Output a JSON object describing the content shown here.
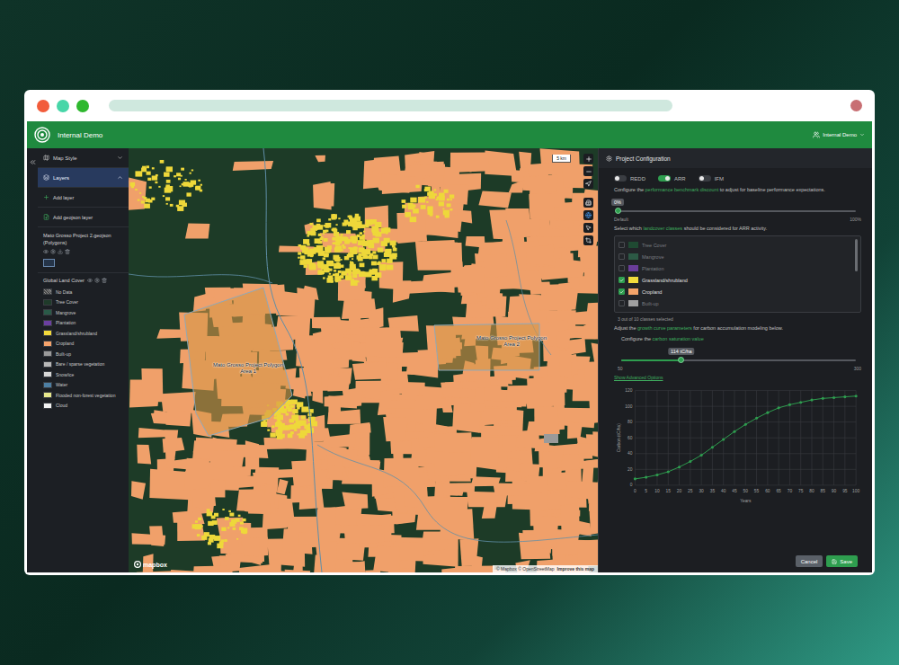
{
  "header": {
    "title": "Internal Demo",
    "account": "Internal Demo"
  },
  "sidebar": {
    "sections": [
      {
        "label": "Map Style",
        "selected": false,
        "expanded": false
      },
      {
        "label": "Layers",
        "selected": true,
        "expanded": true
      }
    ],
    "actions": [
      "Add layer",
      "Add geojson layer"
    ],
    "layer": {
      "name": "Mato Grosso Project 2.geojson (Polygons)"
    },
    "legend": {
      "title": "Global Land Cover",
      "items": [
        {
          "label": "No Data",
          "color": "#4a4a4a",
          "kind": "hatched"
        },
        {
          "label": "Tree Cover",
          "color": "#1f3b2a",
          "kind": "solid"
        },
        {
          "label": "Mangrove",
          "color": "#2a5a48",
          "kind": "solid"
        },
        {
          "label": "Plantation",
          "color": "#6b3fa0",
          "kind": "solid"
        },
        {
          "label": "Grassland/shrubland",
          "color": "#f1d83b",
          "kind": "solid"
        },
        {
          "label": "Cropland",
          "color": "#f4a26b",
          "kind": "solid"
        },
        {
          "label": "Built-up",
          "color": "#9a9a9a",
          "kind": "solid"
        },
        {
          "label": "Bare / sparse vegetation",
          "color": "#b8b8b8",
          "kind": "solid"
        },
        {
          "label": "Snow/ice",
          "color": "#d6d6d6",
          "kind": "solid"
        },
        {
          "label": "Water",
          "color": "#4d7fa3",
          "kind": "solid"
        },
        {
          "label": "Flooded non-forest vegetation",
          "color": "#e6e78c",
          "kind": "solid"
        },
        {
          "label": "Cloud",
          "color": "#f2f2f2",
          "kind": "solid"
        }
      ]
    }
  },
  "map": {
    "scale": "5 km",
    "polygons": [
      {
        "label": "Mato Grosso Project Polygon Area 1"
      },
      {
        "label": "Mato Grosso Project Polygon Area 2"
      }
    ],
    "logo": "mapbox",
    "attribution": "© Mapbox © OpenStreetMap",
    "improve": "Improve this map"
  },
  "config": {
    "title": "Project Configuration",
    "modes": [
      {
        "label": "REDD",
        "selected": false
      },
      {
        "label": "ARR",
        "selected": true
      },
      {
        "label": "IFM",
        "selected": false
      }
    ],
    "benchmark": {
      "text": [
        {
          "text": "Configure the ",
          "link": false
        },
        {
          "text": "performance benchmark discount",
          "link": true
        },
        {
          "text": " to adjust for baseline performance expectations.",
          "link": false
        }
      ],
      "value": "0%",
      "level": 0,
      "min": "Default",
      "max": "100%"
    },
    "landcover": {
      "text": [
        {
          "text": "Select which ",
          "link": false
        },
        {
          "text": "landcover classes",
          "link": true
        },
        {
          "text": " should be considered for ARR activity.",
          "link": false
        }
      ],
      "items": [
        {
          "label": "Tree Cover",
          "checked": false,
          "color": "#1f4a32"
        },
        {
          "label": "Mangrove",
          "checked": false,
          "color": "#2c5945"
        },
        {
          "label": "Plantation",
          "checked": false,
          "color": "#6a3d9a"
        },
        {
          "label": "Grassland/shrubland",
          "checked": true,
          "color": "#f2dc3c"
        },
        {
          "label": "Cropland",
          "checked": true,
          "color": "#f4a46a"
        },
        {
          "label": "Built-up",
          "checked": false,
          "color": "#a0a0a0"
        }
      ],
      "count": "3 out of 10 classes selected"
    },
    "growth": {
      "text": [
        {
          "text": "Adjust the ",
          "link": false
        },
        {
          "text": "growth curve parameters",
          "link": true
        },
        {
          "text": " for carbon accumulation modeling below.",
          "link": false
        }
      ]
    },
    "saturation": {
      "text": [
        {
          "text": "Configure the ",
          "link": false
        },
        {
          "text": "carbon saturation value",
          "link": true
        }
      ],
      "value": "114 tC/ha",
      "level": 0.256,
      "min": "50",
      "max": "300"
    },
    "advanced": "Show Advanced Options",
    "chart": {
      "y_label": "Carbon (tC/ha)",
      "x_label": "Years",
      "y_ticks": [
        "0",
        "20",
        "40",
        "60",
        "80",
        "100",
        "120"
      ],
      "x_ticks": [
        "0",
        "5",
        "10",
        "15",
        "20",
        "25",
        "30",
        "35",
        "40",
        "45",
        "50",
        "55",
        "60",
        "65",
        "70",
        "75",
        "80",
        "85",
        "90",
        "95",
        "100"
      ],
      "series": [
        {
          "years": [
            0,
            5,
            10,
            15,
            20,
            25,
            30,
            35,
            40,
            45,
            50,
            55,
            60,
            65,
            70,
            75,
            80,
            85,
            90,
            95,
            100
          ],
          "values": [
            8,
            10,
            13,
            17,
            23,
            30,
            38,
            48,
            58,
            68,
            77,
            85,
            92,
            98,
            102,
            105,
            108,
            110,
            111,
            112,
            113
          ]
        }
      ]
    },
    "buttons": [
      {
        "label": "Cancel",
        "kind": "secondary"
      },
      {
        "label": "Save",
        "kind": "primary"
      }
    ]
  }
}
